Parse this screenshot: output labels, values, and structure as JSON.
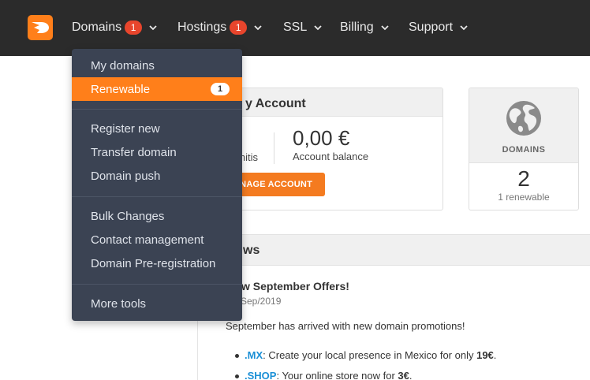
{
  "nav": {
    "items": [
      {
        "label": "Domains",
        "badge": "1"
      },
      {
        "label": "Hostings",
        "badge": "1"
      },
      {
        "label": "SSL"
      },
      {
        "label": "Billing"
      },
      {
        "label": "Support"
      }
    ]
  },
  "dropdown": {
    "groups": [
      [
        {
          "label": "My domains"
        },
        {
          "label": "Renewable",
          "badge": "1",
          "active": true
        }
      ],
      [
        {
          "label": "Register new"
        },
        {
          "label": "Transfer domain"
        },
        {
          "label": "Domain push"
        }
      ],
      [
        {
          "label": "Bulk Changes"
        },
        {
          "label": "Contact management"
        },
        {
          "label": "Domain Pre-registration"
        }
      ],
      [
        {
          "label": "More tools"
        }
      ]
    ]
  },
  "account": {
    "title_partial": "y Account",
    "credits_partial": "nitis",
    "balance_value": "0,00 €",
    "balance_label": "Account balance",
    "manage_partial": "NAGE ACCOUNT"
  },
  "domains_card": {
    "label": "DOMAINS",
    "count": "2",
    "sub": "1 renewable"
  },
  "news": {
    "title_partial": "ws",
    "offer_title_partial": "w September Offers!",
    "offer_date_partial": "Sep/2019",
    "intro": "September has arrived with new domain promotions!",
    "items": [
      {
        "tld": ".MX",
        "text": ": Create your local presence in Mexico for only ",
        "price": "19€",
        "end": "."
      },
      {
        "tld": ".SHOP",
        "text": ": Your online store now for ",
        "price": "3€",
        "end": "."
      }
    ]
  },
  "colors": {
    "accent": "#ff7f1a",
    "topbar": "#2b2b2b",
    "dropdown_bg": "#3b4353",
    "badge_red": "#e8452c",
    "link_blue": "#1a8fd6"
  }
}
